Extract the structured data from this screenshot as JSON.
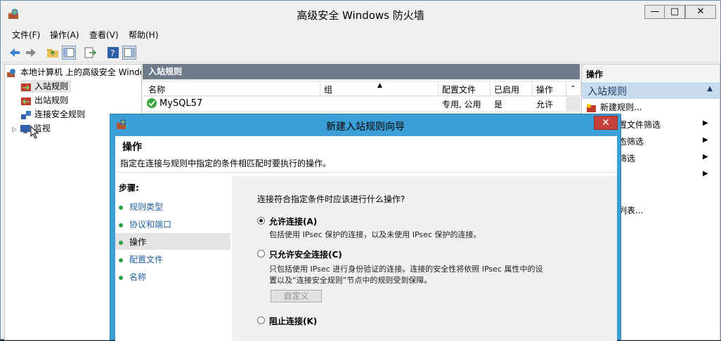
{
  "window": {
    "title": "高级安全 Windows 防火墙"
  },
  "menu": [
    "文件(F)",
    "操作(A)",
    "查看(V)",
    "帮助(H)"
  ],
  "tree": {
    "root": "本地计算机 上的高级安全 Windows",
    "items": [
      "入站规则",
      "出站规则",
      "连接安全规则",
      "监视"
    ]
  },
  "middle": {
    "header": "入站规则",
    "columns": [
      "名称",
      "组",
      "配置文件",
      "已启用",
      "操作"
    ],
    "rows": [
      {
        "name": "MySQL57",
        "group": "",
        "profile": "专用, 公用",
        "enabled": "是",
        "action": "允许"
      }
    ]
  },
  "actions": {
    "header": "操作",
    "section": "入站规则",
    "items": [
      "新建规则...",
      "置文件筛选",
      "态筛选",
      "筛选",
      "",
      "列表..."
    ]
  },
  "dialog": {
    "title": "新建入站规则向导",
    "page_title": "操作",
    "page_subtitle": "指定在连接与规则中指定的条件相匹配时要执行的操作。",
    "steps_label": "步骤:",
    "steps": [
      "规则类型",
      "协议和端口",
      "操作",
      "配置文件",
      "名称"
    ],
    "question": "连接符合指定条件时应该进行什么操作?",
    "options": [
      {
        "label": "允许连接(A)",
        "desc": "包括使用 IPsec 保护的连接，以及未使用 IPsec 保护的连接。",
        "selected": true
      },
      {
        "label": "只允许安全连接(C)",
        "desc1": "只包括使用 IPsec 进行身份验证的连接。连接的安全性将依照 IPsec 属性中的设",
        "desc2": "置以及“连接安全规则”节点中的规则受到保障。",
        "selected": false
      },
      {
        "label": "阻止连接(K)",
        "selected": false
      }
    ],
    "customize_button": "自定义"
  }
}
